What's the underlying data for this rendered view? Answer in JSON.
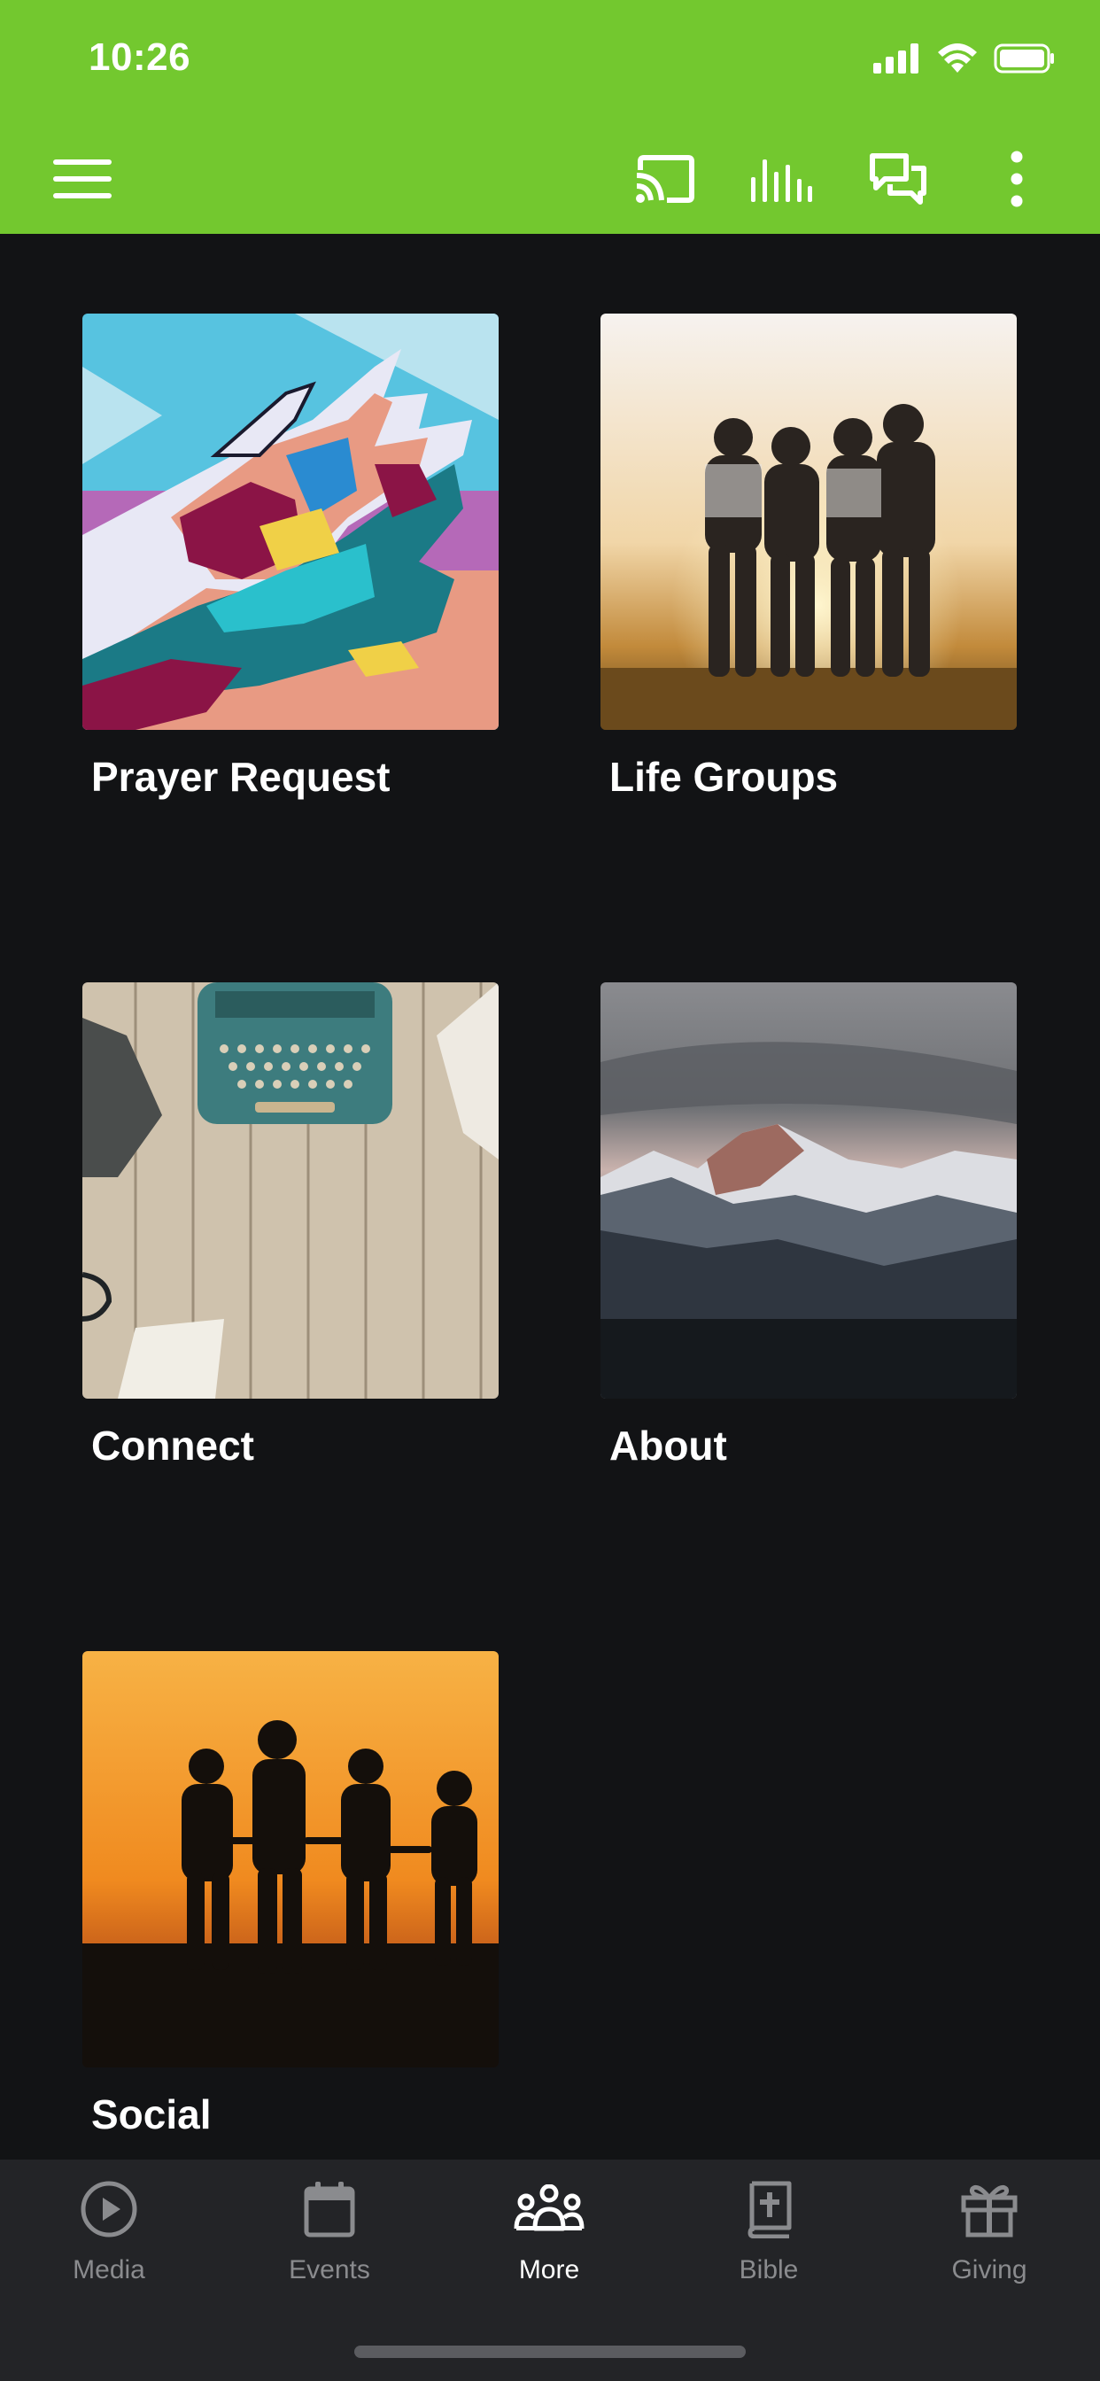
{
  "status_bar": {
    "time": "10:26"
  },
  "app_bar": {
    "icons": [
      "menu-icon",
      "cast-icon",
      "audio-bars-icon",
      "chat-icon",
      "more-vertical-icon"
    ],
    "colors": {
      "background": "#73c82f"
    }
  },
  "tiles": [
    {
      "label": "Prayer Request",
      "image": "colorful-hands-mural"
    },
    {
      "label": "Life Groups",
      "image": "friends-sunset"
    },
    {
      "label": "Connect",
      "image": "typewriter-desk"
    },
    {
      "label": "About",
      "image": "mountain-peaks"
    },
    {
      "label": "Social",
      "image": "silhouettes-orange-sky"
    }
  ],
  "bottom_nav": {
    "items": [
      {
        "label": "Media",
        "icon": "play-circle-icon",
        "active": false
      },
      {
        "label": "Events",
        "icon": "calendar-icon",
        "active": false
      },
      {
        "label": "More",
        "icon": "people-group-icon",
        "active": true
      },
      {
        "label": "Bible",
        "icon": "bible-icon",
        "active": false
      },
      {
        "label": "Giving",
        "icon": "gift-icon",
        "active": false
      }
    ]
  },
  "colors": {
    "page_background": "#121315",
    "nav_background": "#232427",
    "nav_inactive": "#8a8b8e"
  }
}
